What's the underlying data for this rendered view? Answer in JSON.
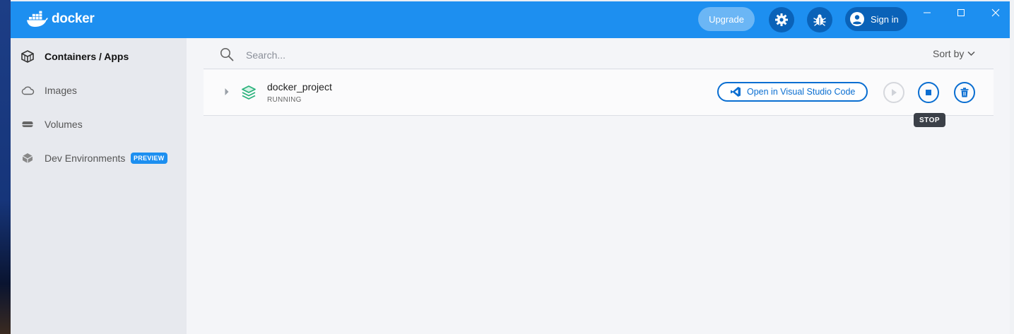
{
  "app": {
    "brand": "docker",
    "accent": "#1d8ff0",
    "dark_accent": "#0a62b8"
  },
  "header": {
    "upgrade_label": "Upgrade",
    "settings_icon": "gear-icon",
    "troubleshoot_icon": "bug-icon",
    "signin_label": "Sign in"
  },
  "sidebar": {
    "items": [
      {
        "label": "Containers / Apps",
        "icon": "container-icon",
        "active": true
      },
      {
        "label": "Images",
        "icon": "cloud-icon",
        "active": false
      },
      {
        "label": "Volumes",
        "icon": "volume-icon",
        "active": false
      },
      {
        "label": "Dev Environments",
        "icon": "dev-env-icon",
        "active": false,
        "badge": "PREVIEW"
      }
    ]
  },
  "main": {
    "search": {
      "placeholder": "Search...",
      "value": ""
    },
    "sort_label": "Sort by",
    "rows": [
      {
        "name": "docker_project",
        "status": "RUNNING",
        "open_vscode_label": "Open in Visual Studio Code"
      }
    ],
    "tooltip": "STOP"
  }
}
